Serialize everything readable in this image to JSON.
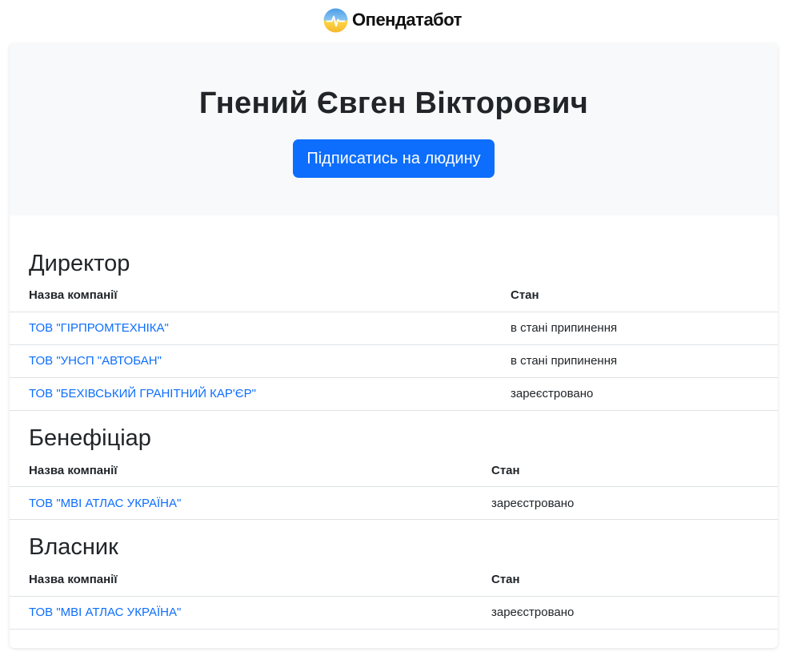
{
  "brand": {
    "name": "Опендатабот",
    "logo_icon": "opendatabot-logo-icon"
  },
  "person": {
    "name": "Гнений Євген Вікторович",
    "subscribe_label": "Підписатись на людину"
  },
  "colors": {
    "accent": "#0d6efd",
    "hero_bg": "#f8f9fa"
  },
  "sections": [
    {
      "title": "Директор",
      "headers": [
        "Назва компанії",
        "Стан"
      ],
      "rows": [
        {
          "company": "ТОВ \"ГІРПРОМТЕХНІКА\"",
          "status": "в стані припинення"
        },
        {
          "company": "ТОВ \"УНСП \"АВТОБАН\"",
          "status": "в стані припинення"
        },
        {
          "company": "ТОВ \"БЕХІВСЬКИЙ ГРАНІТНИЙ КАР'ЄР\"",
          "status": "зареєстровано"
        }
      ]
    },
    {
      "title": "Бенефіціар",
      "headers": [
        "Назва компанії",
        "Стан"
      ],
      "rows": [
        {
          "company": "ТОВ \"МВІ АТЛАС УКРАЇНА\"",
          "status": "зареєстровано"
        }
      ]
    },
    {
      "title": "Власник",
      "headers": [
        "Назва компанії",
        "Стан"
      ],
      "rows": [
        {
          "company": "ТОВ \"МВІ АТЛАС УКРАЇНА\"",
          "status": "зареєстровано"
        }
      ]
    }
  ]
}
